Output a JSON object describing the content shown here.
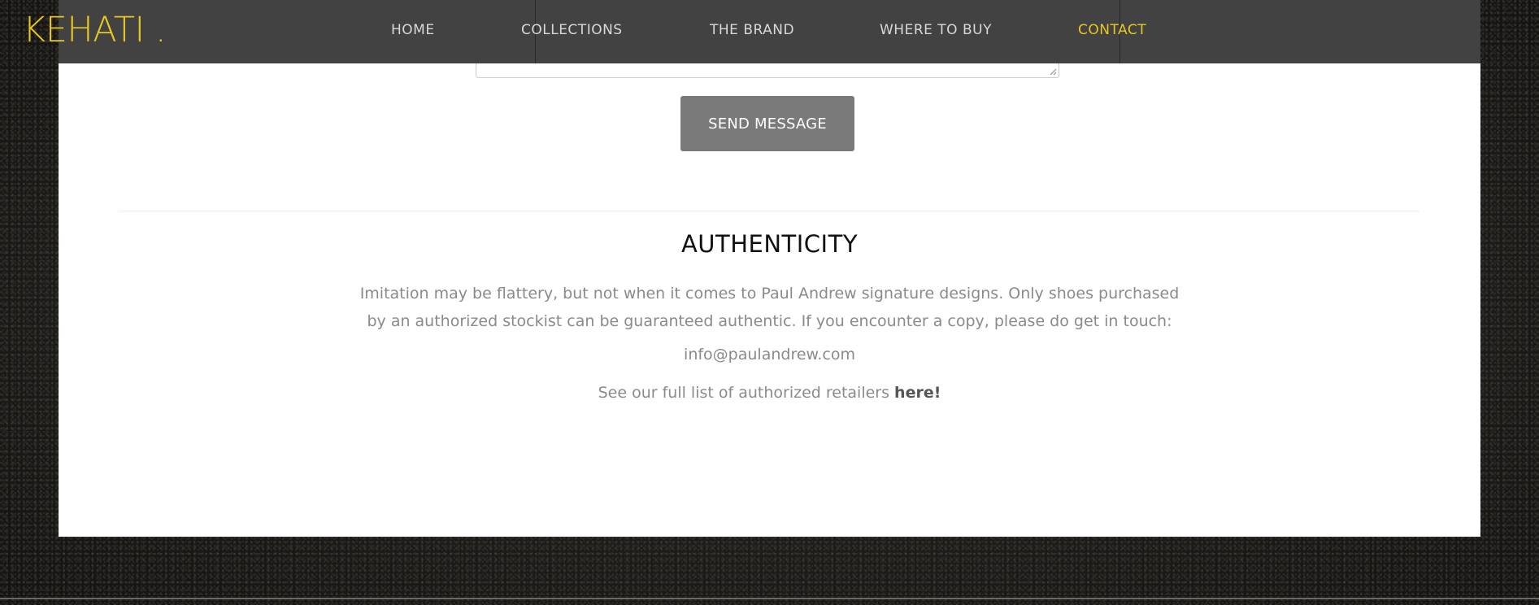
{
  "brand": {
    "logo_text": "KEHATI ."
  },
  "nav": {
    "items": [
      {
        "label": "HOME",
        "active": false
      },
      {
        "label": "COLLECTIONS",
        "active": false
      },
      {
        "label": "THE BRAND",
        "active": false
      },
      {
        "label": "WHERE TO BUY",
        "active": false
      },
      {
        "label": "CONTACT",
        "active": true
      }
    ]
  },
  "form": {
    "message_value": "",
    "send_label": "SEND MESSAGE"
  },
  "authenticity": {
    "title": "AUTHENTICITY",
    "body": "Imitation may be flattery, but not when it comes to Paul Andrew signature designs. Only shoes purchased by an authorized stockist can be guaranteed authentic. If you encounter a copy, please do get in touch:",
    "email": "info@paulandrew.com",
    "retailers_text": "See our full list of authorized retailers ",
    "retailers_link": "here!"
  },
  "colors": {
    "accent": "#e8c820",
    "navbar_bg": "#3c3c3c",
    "button_bg": "#7a7a7a",
    "body_text": "#8a8a8a",
    "heading_text": "#111111"
  },
  "icons": {
    "resize_handle": "resize-handle-icon"
  }
}
